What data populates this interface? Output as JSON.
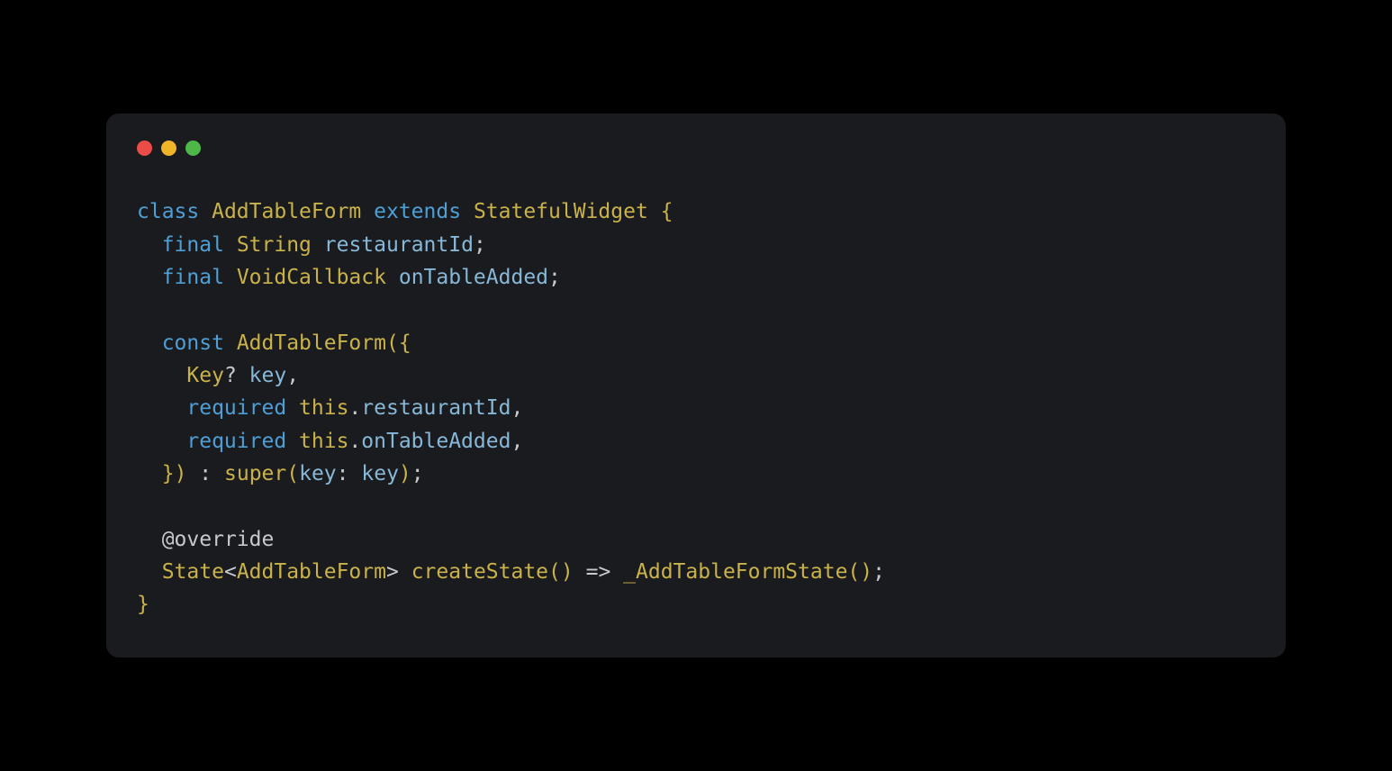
{
  "window": {
    "traffic_light_colors": {
      "red": "#ec4c47",
      "yellow": "#f0b429",
      "green": "#4db748"
    }
  },
  "code": {
    "kw_class": "class",
    "type_AddTableForm": "AddTableForm",
    "kw_extends": "extends",
    "type_StatefulWidget": "StatefulWidget",
    "brace_open": "{",
    "brace_close": "}",
    "paren_open": "(",
    "paren_close": ")",
    "kw_final": "final",
    "type_String": "String",
    "field_restaurantId": "restaurantId",
    "type_VoidCallback": "VoidCallback",
    "field_onTableAdded": "onTableAdded",
    "kw_const": "const",
    "type_Key": "Key",
    "qmark": "?",
    "param_key": "key",
    "kw_required": "required",
    "kw_this": "this",
    "colon": ":",
    "call_super": "super",
    "label_key": "key",
    "semi": ";",
    "comma": ",",
    "dot": ".",
    "angle_open": "<",
    "angle_close": ">",
    "arrow": "=>",
    "meta_override": "@override",
    "type_State": "State",
    "fn_createState": "createState",
    "fn_AddTableFormState": "_AddTableFormState"
  }
}
